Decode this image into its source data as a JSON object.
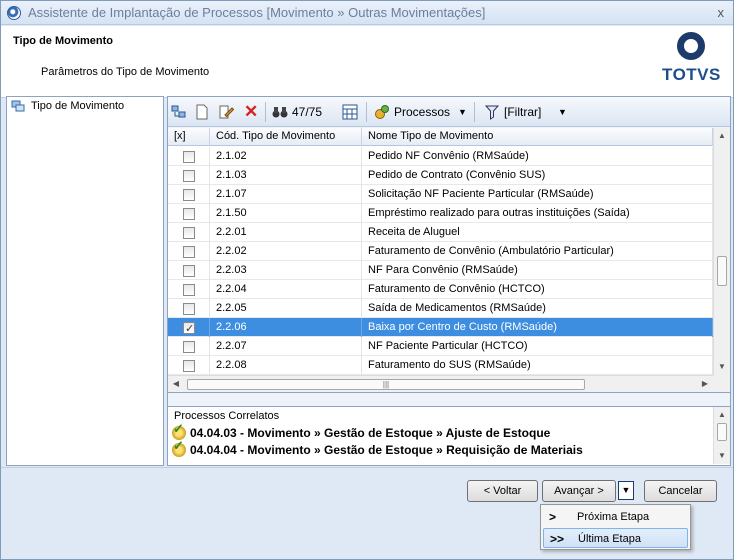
{
  "window": {
    "title": "Assistente de Implantação de Processos [Movimento » Outras Movimentações]",
    "close": "x"
  },
  "header": {
    "title": "Tipo de Movimento",
    "subtitle": "Parâmetros do Tipo de Movimento",
    "logo": "TOTVS"
  },
  "tree": {
    "item": "Tipo de Movimento"
  },
  "toolbar": {
    "record_count": "47/75",
    "processos_label": "Processos",
    "filtrar_label": "[Filtrar]"
  },
  "grid": {
    "headers": [
      "[x]",
      "Cód. Tipo de Movimento",
      "Nome Tipo de Movimento"
    ],
    "rows": [
      {
        "code": "2.1.02",
        "name": "Pedido NF Convênio (RMSaúde)",
        "checked": false
      },
      {
        "code": "2.1.03",
        "name": "Pedido de Contrato (Convênio SUS)",
        "checked": false
      },
      {
        "code": "2.1.07",
        "name": "Solicitação NF Paciente Particular (RMSaúde)",
        "checked": false
      },
      {
        "code": "2.1.50",
        "name": "Empréstimo realizado para outras instituições (Saída)",
        "checked": false
      },
      {
        "code": "2.2.01",
        "name": "Receita de Aluguel",
        "checked": false
      },
      {
        "code": "2.2.02",
        "name": "Faturamento de Convênio (Ambulatório Particular)",
        "checked": false
      },
      {
        "code": "2.2.03",
        "name": "NF Para Convênio (RMSaúde)",
        "checked": false
      },
      {
        "code": "2.2.04",
        "name": "Faturamento de Convênio (HCTCO)",
        "checked": false
      },
      {
        "code": "2.2.05",
        "name": "Saída de Medicamentos (RMSaúde)",
        "checked": false
      },
      {
        "code": "2.2.06",
        "name": "Baixa por Centro de Custo (RMSaúde)",
        "checked": true
      },
      {
        "code": "2.2.07",
        "name": "NF Paciente Particular (HCTCO)",
        "checked": false
      },
      {
        "code": "2.2.08",
        "name": "Faturamento do SUS (RMSaúde)",
        "checked": false
      }
    ],
    "selected_index": 9
  },
  "related": {
    "title": "Processos Correlatos",
    "items": [
      "04.04.03 - Movimento » Gestão de Estoque » Ajuste de Estoque",
      "04.04.04 - Movimento » Gestão de Estoque » Requisição de Materiais"
    ]
  },
  "footer": {
    "voltar": "< Voltar",
    "avancar": "Avançar >",
    "cancelar": "Cancelar"
  },
  "menu": {
    "items": [
      {
        "arrow": ">",
        "label": "Próxima Etapa"
      },
      {
        "arrow": ">>",
        "label": "Última Etapa"
      }
    ],
    "highlighted_index": 1
  }
}
